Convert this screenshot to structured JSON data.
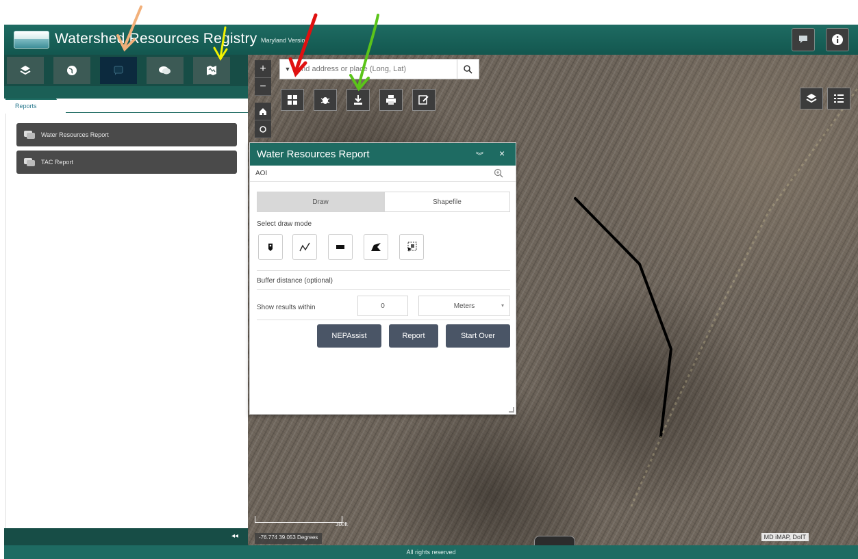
{
  "app": {
    "title": "Watershed Resources Registry",
    "subtitle": "Maryland Version",
    "footer": "All rights reserved"
  },
  "header_buttons": [
    {
      "name": "feedback-button",
      "icon": "chat-icon"
    },
    {
      "name": "about-button",
      "icon": "info-icon"
    }
  ],
  "left_panel": {
    "tabs": [
      {
        "icon": "layers-icon",
        "active": false
      },
      {
        "icon": "globe-icon",
        "active": false
      },
      {
        "icon": "report-icon",
        "active": true
      },
      {
        "icon": "chat-icon",
        "active": false
      },
      {
        "icon": "map-icon",
        "active": false
      }
    ],
    "section_tab": "Reports",
    "report_items": [
      {
        "label": "Water Resources Report"
      },
      {
        "label": "TAC Report"
      }
    ],
    "collapse_label": "◂◂"
  },
  "map": {
    "search_placeholder": "Find address or place (Long, Lat)",
    "scale_label": "300ft",
    "coordinates": "-76.774 39.053 Degrees",
    "attribution": "MD iMAP, DoIT",
    "toolbar_icons": [
      "grid-icon",
      "bug-icon",
      "download-icon",
      "print-icon",
      "edit-icon"
    ],
    "right_icons": [
      "layers-icon",
      "list-icon"
    ]
  },
  "report_window": {
    "title": "Water Resources Report",
    "aoi_label": "AOI",
    "segments": [
      "Draw",
      "Shapefile"
    ],
    "draw_mode_label": "Select draw mode",
    "draw_modes": [
      "point-icon",
      "polyline-icon",
      "rectangle-icon",
      "polygon-icon",
      "select-icon"
    ],
    "buffer_label": "Buffer distance (optional)",
    "within_label": "Show results within",
    "distance_value": "0",
    "unit_value": "Meters",
    "buttons": [
      "NEPAssist",
      "Report",
      "Start Over"
    ]
  },
  "colors": {
    "header": "#1e6b62",
    "panel_dark": "#174d46",
    "button": "#4a5566",
    "annotation_orange": "#f2b07a",
    "annotation_yellow": "#f2f200",
    "annotation_red": "#e01010",
    "annotation_green": "#5bc41a"
  }
}
